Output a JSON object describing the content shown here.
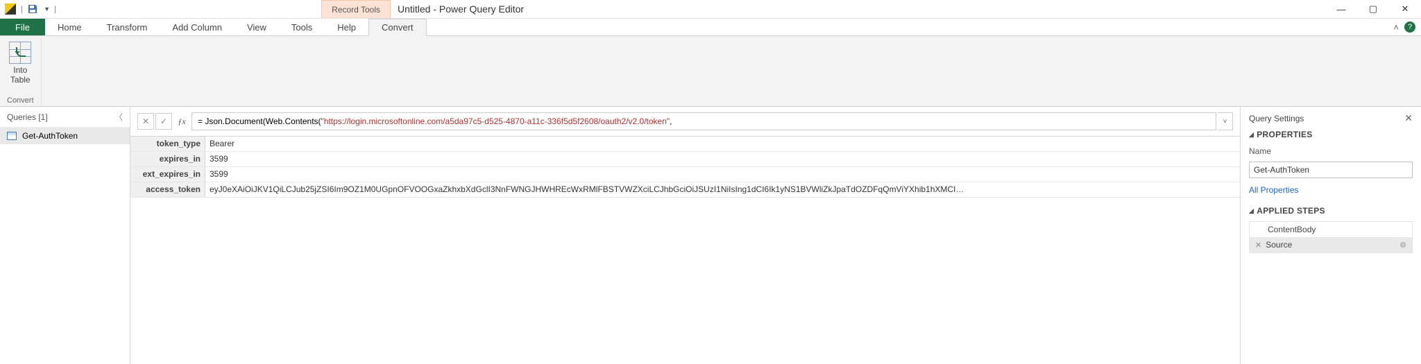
{
  "titlebar": {
    "record_tools": "Record Tools",
    "window_title": "Untitled - Power Query Editor"
  },
  "menu": {
    "file": "File",
    "home": "Home",
    "transform": "Transform",
    "add_column": "Add Column",
    "view": "View",
    "tools": "Tools",
    "help": "Help",
    "convert": "Convert"
  },
  "ribbon": {
    "into_table": "Into\nTable",
    "group_convert": "Convert"
  },
  "queries": {
    "header": "Queries [1]",
    "items": [
      "Get-AuthToken"
    ]
  },
  "formula": {
    "prefix": "= Json.Document(Web.Contents(",
    "url": "\"https://login.microsoftonline.com/a5da97c5-d525-4870-a11c-336f5d5f2608/oauth2/v2.0/token\"",
    "suffix": ","
  },
  "record": {
    "rows": [
      {
        "k": "token_type",
        "v": "Bearer"
      },
      {
        "k": "expires_in",
        "v": "3599"
      },
      {
        "k": "ext_expires_in",
        "v": "3599"
      },
      {
        "k": "access_token",
        "v": "eyJ0eXAiOiJKV1QiLCJub25jZSI6Im9OZ1M0UGpnOFVOOGxaZkhxbXdGclI3NnFWNGJHWHREcWxRMlFBSTVWZXciLCJhbGciOiJSUzI1NiIsIng1dCI6Ik1yNS1BVWliZkJpaTdOZDFqQmViYXhib1hXMCI…"
      }
    ]
  },
  "settings": {
    "title": "Query Settings",
    "properties": "PROPERTIES",
    "name_label": "Name",
    "name_value": "Get-AuthToken",
    "all_properties": "All Properties",
    "applied_steps": "APPLIED STEPS",
    "steps": [
      "ContentBody",
      "Source"
    ]
  }
}
